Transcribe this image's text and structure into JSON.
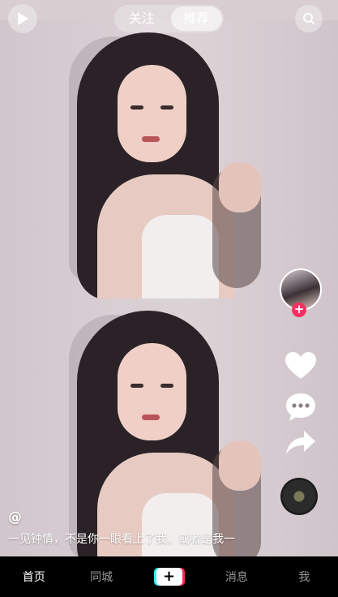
{
  "header": {
    "tabs": [
      {
        "label": "关注",
        "active": false
      },
      {
        "label": "推荐",
        "active": true
      }
    ]
  },
  "video": {
    "author": "@",
    "description": "一见钟情，不是你一眼看上了我，或者是我一"
  },
  "side_actions": {
    "follow_symbol": "+",
    "icons": [
      "avatar",
      "heart-icon",
      "comment-icon",
      "share-icon",
      "music-disc"
    ]
  },
  "navbar": {
    "items": [
      {
        "label": "首页",
        "active": true
      },
      {
        "label": "同城",
        "active": false
      },
      {
        "label": "+",
        "active": false
      },
      {
        "label": "消息",
        "active": false
      },
      {
        "label": "我",
        "active": false
      }
    ]
  },
  "colors": {
    "accent_red": "#ff2e63",
    "nav_background": "#000000",
    "nav_inactive": "#9a9a9a"
  }
}
